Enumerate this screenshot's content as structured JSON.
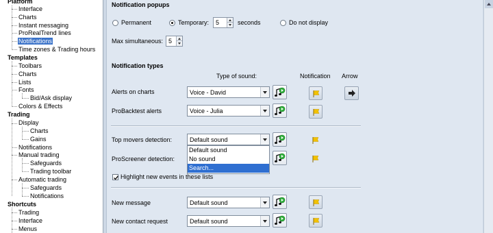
{
  "tree": {
    "items": [
      {
        "label": "Platform",
        "level": 0
      },
      {
        "label": "Interface",
        "level": 1
      },
      {
        "label": "Charts",
        "level": 1
      },
      {
        "label": "Instant messaging",
        "level": 1
      },
      {
        "label": "ProRealTrend lines",
        "level": 1
      },
      {
        "label": "Notifications",
        "level": 1,
        "selected": true
      },
      {
        "label": "Time zones & Trading hours",
        "level": 1
      },
      {
        "label": "Templates",
        "level": 0
      },
      {
        "label": "Toolbars",
        "level": 1
      },
      {
        "label": "Charts",
        "level": 1
      },
      {
        "label": "Lists",
        "level": 1
      },
      {
        "label": "Fonts",
        "level": 1
      },
      {
        "label": "Bid/Ask display",
        "level": 2
      },
      {
        "label": "Colors & Effects",
        "level": 1
      },
      {
        "label": "Trading",
        "level": 0
      },
      {
        "label": "Display",
        "level": 1
      },
      {
        "label": "Charts",
        "level": 2
      },
      {
        "label": "Gains",
        "level": 2
      },
      {
        "label": "Notifications",
        "level": 1
      },
      {
        "label": "Manual trading",
        "level": 1
      },
      {
        "label": "Safeguards",
        "level": 2
      },
      {
        "label": "Trading toolbar",
        "level": 2
      },
      {
        "label": "Automatic trading",
        "level": 1
      },
      {
        "label": "Safeguards",
        "level": 2
      },
      {
        "label": "Notifications",
        "level": 2
      },
      {
        "label": "Shortcuts",
        "level": 0
      },
      {
        "label": "Trading",
        "level": 1
      },
      {
        "label": "Interface",
        "level": 1
      },
      {
        "label": "Menus",
        "level": 1
      }
    ]
  },
  "popups": {
    "title": "Notification popups",
    "permanent_label": "Permanent",
    "temporary_label": "Temporary:",
    "temporary_value": "5",
    "seconds_label": "seconds",
    "donot_label": "Do not display",
    "selected": "temporary",
    "max_label": "Max simultaneous:",
    "max_value": "5"
  },
  "types": {
    "title": "Notification types",
    "col_sound": "Type of sound:",
    "col_notification": "Notification",
    "col_arrow": "Arrow"
  },
  "rows": {
    "alerts": {
      "label": "Alerts on charts",
      "sound": "Voice - David"
    },
    "backtest": {
      "label": "ProBacktest alerts",
      "sound": "Voice - Julia"
    },
    "topmovers": {
      "label": "Top movers detection:",
      "sound": "Default sound"
    },
    "screener": {
      "label": "ProScreener detection:"
    },
    "highlight_label": "Highlight new events in these lists",
    "highlight_checked": true,
    "newmsg": {
      "label": "New message",
      "sound": "Default sound"
    },
    "contact": {
      "label": "New contact request",
      "sound": "Default sound"
    }
  },
  "dropdown": {
    "options": [
      "Default sound",
      "No sound",
      "Search..."
    ],
    "highlighted": "Search..."
  },
  "icons": {
    "play": "play-sound-icon",
    "flag": "flag-icon",
    "arrow": "arrow-right-icon"
  },
  "colors": {
    "selection": "#3b73c9",
    "flag": "#f2c200",
    "play": "#2fae3a"
  }
}
